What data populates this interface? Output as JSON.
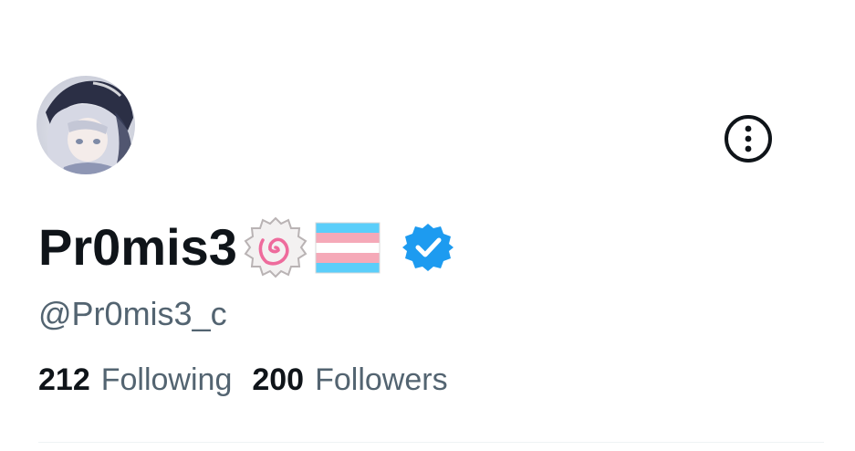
{
  "profile": {
    "display_name": "Pr0mis3",
    "handle": "@Pr0mis3_c",
    "name_emojis": [
      "narutomaki-emoji",
      "transgender-flag-emoji"
    ],
    "verified": true,
    "verified_color": "#1d9bf0"
  },
  "stats": {
    "following_count": "212",
    "following_label": "Following",
    "followers_count": "200",
    "followers_label": "Followers"
  },
  "actions": {
    "more_icon": "more-vertical-circle-icon"
  },
  "colors": {
    "text_primary": "#0f1419",
    "text_secondary": "#536471",
    "divider": "#eff3f4",
    "trans_blue": "#5bcefa",
    "trans_pink": "#f5a9b8"
  }
}
